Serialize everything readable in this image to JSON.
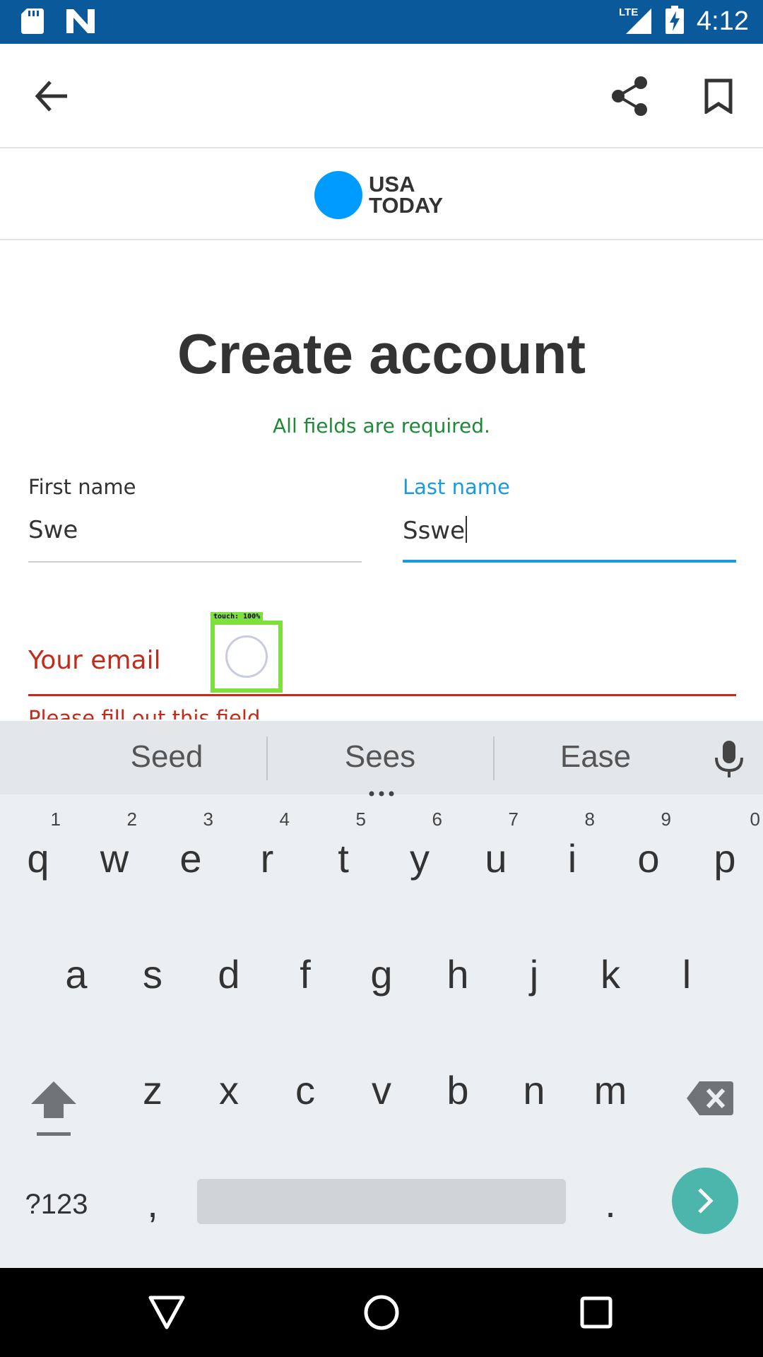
{
  "status_bar": {
    "time": "4:12",
    "network": "LTE",
    "icons": [
      "sd-card-icon",
      "n-notification-icon",
      "signal-icon",
      "battery-charging-icon"
    ]
  },
  "app_bar": {
    "icons": [
      "back-arrow-icon",
      "share-icon",
      "bookmark-icon"
    ]
  },
  "logo": {
    "line1": "USA",
    "line2": "TODAY",
    "dot_color": "#009bff"
  },
  "form": {
    "title": "Create account",
    "required_note": "All fields are required.",
    "first_name": {
      "label": "First name",
      "value": "Swe"
    },
    "last_name": {
      "label": "Last name",
      "value": "Sswe"
    },
    "email": {
      "label": "Your email",
      "value": "",
      "error": "Please fill out this field"
    }
  },
  "touch_overlay": {
    "label": "touch: 100%",
    "color": "#7ee03c"
  },
  "keyboard": {
    "suggestions": [
      "Seed",
      "Sees",
      "Ease"
    ],
    "row1": [
      {
        "key": "q",
        "hint": "1"
      },
      {
        "key": "w",
        "hint": "2"
      },
      {
        "key": "e",
        "hint": "3"
      },
      {
        "key": "r",
        "hint": "4"
      },
      {
        "key": "t",
        "hint": "5"
      },
      {
        "key": "y",
        "hint": "6"
      },
      {
        "key": "u",
        "hint": "7"
      },
      {
        "key": "i",
        "hint": "8"
      },
      {
        "key": "o",
        "hint": "9"
      },
      {
        "key": "p",
        "hint": "0"
      }
    ],
    "row2": [
      "a",
      "s",
      "d",
      "f",
      "g",
      "h",
      "j",
      "k",
      "l"
    ],
    "row3": [
      "z",
      "x",
      "c",
      "v",
      "b",
      "n",
      "m"
    ],
    "symbols_key": "?123",
    "comma_key": ",",
    "period_key": ".",
    "enter_color": "#4db6ac"
  },
  "colors": {
    "status_bar": "#0a5a9b",
    "accent": "#1a9be0",
    "error": "#c42a1a",
    "success": "#1e8a38"
  }
}
